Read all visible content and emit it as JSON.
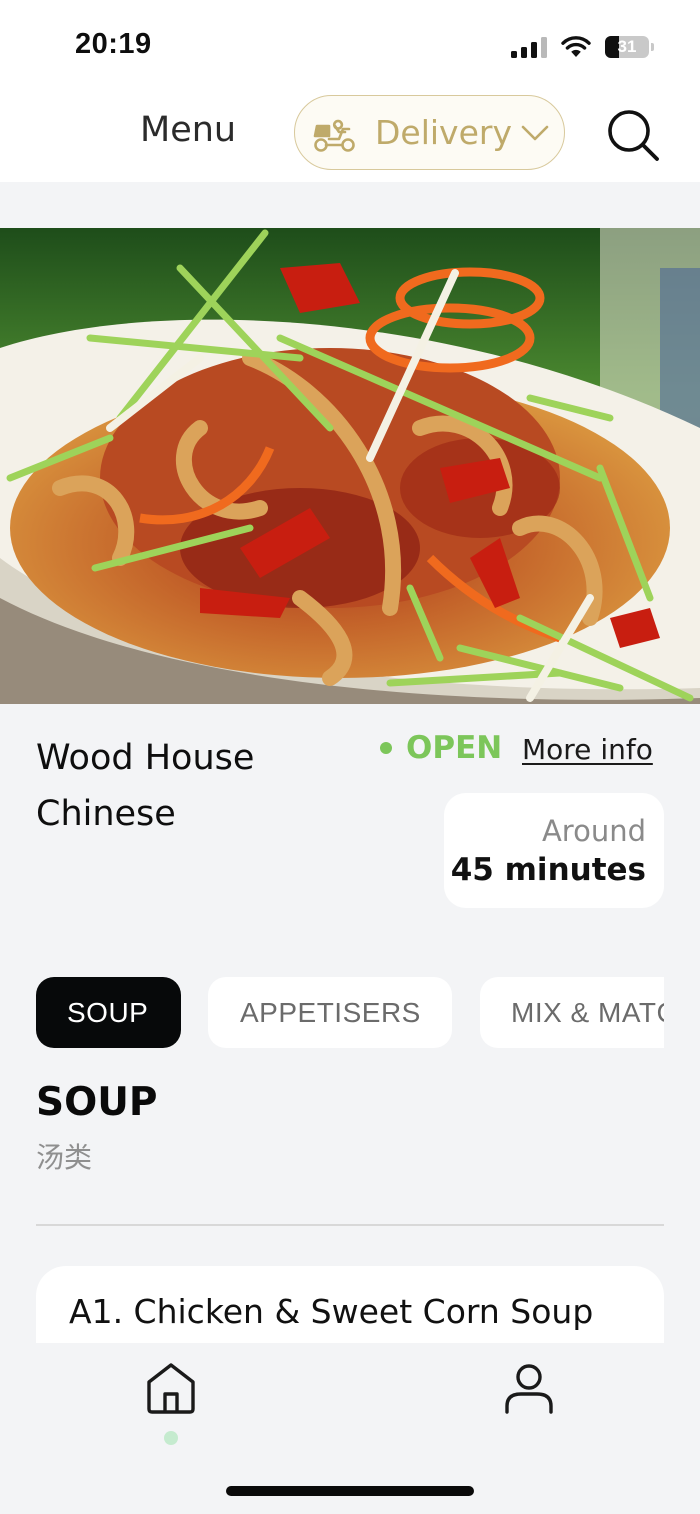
{
  "status_bar": {
    "time": "20:19",
    "battery_level": "31",
    "battery_fraction": 0.31
  },
  "header": {
    "title": "Menu",
    "order_mode": "Delivery",
    "search_icon": "search-icon",
    "delivery_icon": "scooter-icon",
    "accent_color": "#bfaa6a"
  },
  "hero": {
    "image": "salt and pepper squid with chillies and spring onions"
  },
  "restaurant": {
    "name": "Wood House Chinese",
    "status": "OPEN",
    "status_color": "#7cc65a",
    "more_info": "More info",
    "eta_prefix": "Around",
    "eta_value": "45 minutes"
  },
  "categories": {
    "tabs": [
      "SOUP",
      "APPETISERS",
      "MIX &  MATCH"
    ],
    "active": "SOUP"
  },
  "section": {
    "title": "SOUP",
    "subtitle": "汤类"
  },
  "menu_items": [
    {
      "name": "A1. Chicken & Sweet Corn Soup"
    }
  ],
  "bottom_nav": {
    "items": [
      {
        "icon": "home-icon",
        "active": true
      },
      {
        "icon": "profile-icon",
        "active": false
      }
    ]
  }
}
